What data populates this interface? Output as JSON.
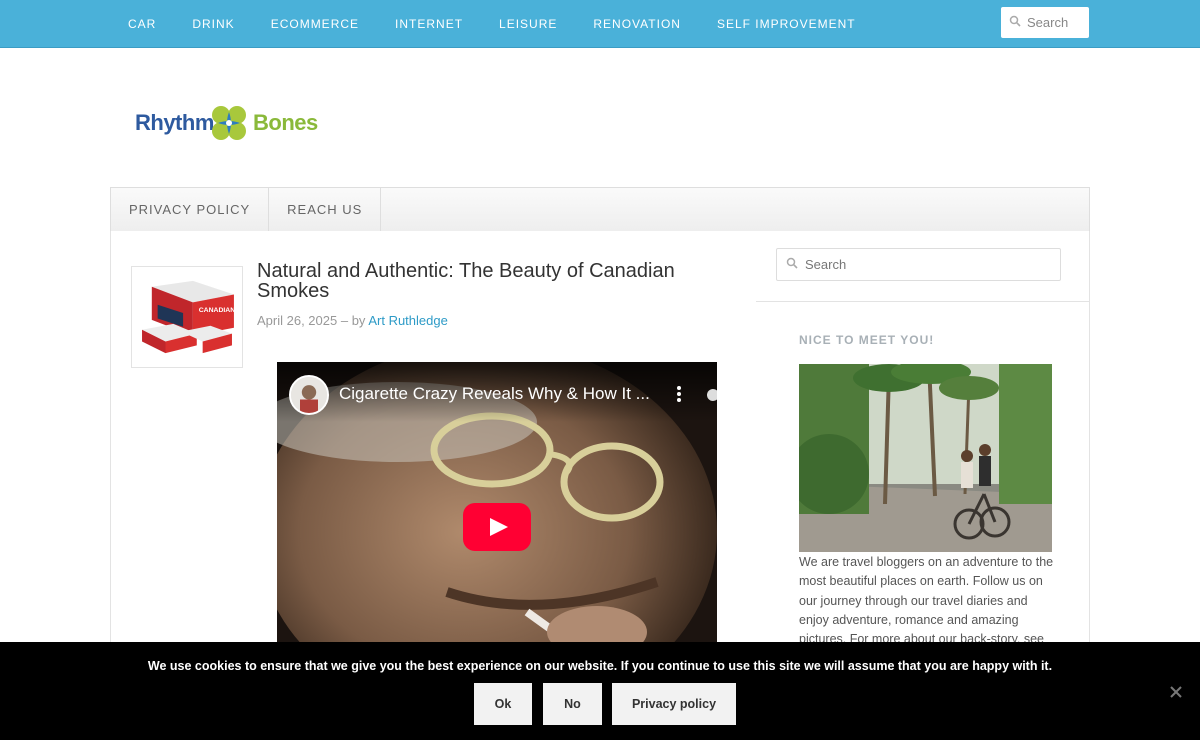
{
  "top_nav": {
    "items": [
      "Car",
      "Drink",
      "Ecommerce",
      "Internet",
      "Leisure",
      "Renovation",
      "Self Improvement"
    ],
    "search_placeholder": "Search"
  },
  "logo": {
    "word_left": "Rhythm",
    "word_right": "Bones"
  },
  "sub_nav": {
    "items": [
      "Privacy Policy",
      "Reach Us"
    ]
  },
  "post": {
    "thumbnail_label": "CANADIAN",
    "title": "Natural and Authentic: The Beauty of Canadian Smokes",
    "date": "April 26, 2025",
    "by_text": "– by",
    "author": "Art Ruthledge",
    "video": {
      "title": "Cigarette Crazy Reveals Why & How It ..."
    }
  },
  "sidebar": {
    "search_placeholder": "Search",
    "widget_title": "Nice to meet you!",
    "widget_text": "We are travel bloggers on an adventure to the most beautiful places on earth. Follow us on our journey through our travel diaries and enjoy adventure, romance and amazing pictures. For more about our back-story, see"
  },
  "cookie": {
    "message": "We use cookies to ensure that we give you the best experience on our website. If you continue to use this site we will assume that you are happy with it.",
    "ok_label": "Ok",
    "no_label": "No",
    "privacy_label": "Privacy policy"
  },
  "colors": {
    "topbar": "#4ab1d9",
    "link": "#2e9bc7",
    "logo_blue": "#2e5a9f",
    "logo_green": "#8ab93a",
    "youtube_red": "#ff0033"
  }
}
